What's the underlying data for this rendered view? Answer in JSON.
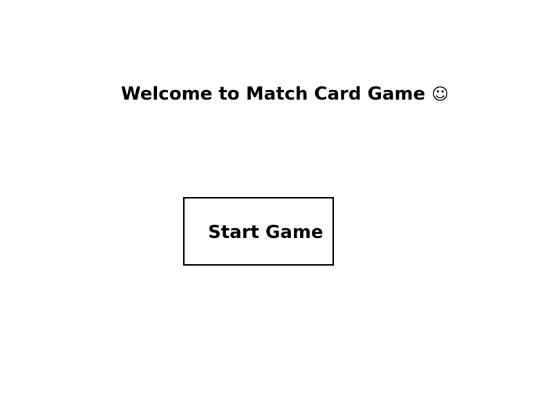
{
  "welcome": {
    "title": "Welcome to Match Card Game",
    "emoji": "☺"
  },
  "menu": {
    "start_label": "Start Game"
  },
  "colors": {
    "background": "#ffffff",
    "text": "#000000",
    "button_border": "#000000"
  },
  "icons": {
    "smiley": "smiley-face-icon"
  }
}
